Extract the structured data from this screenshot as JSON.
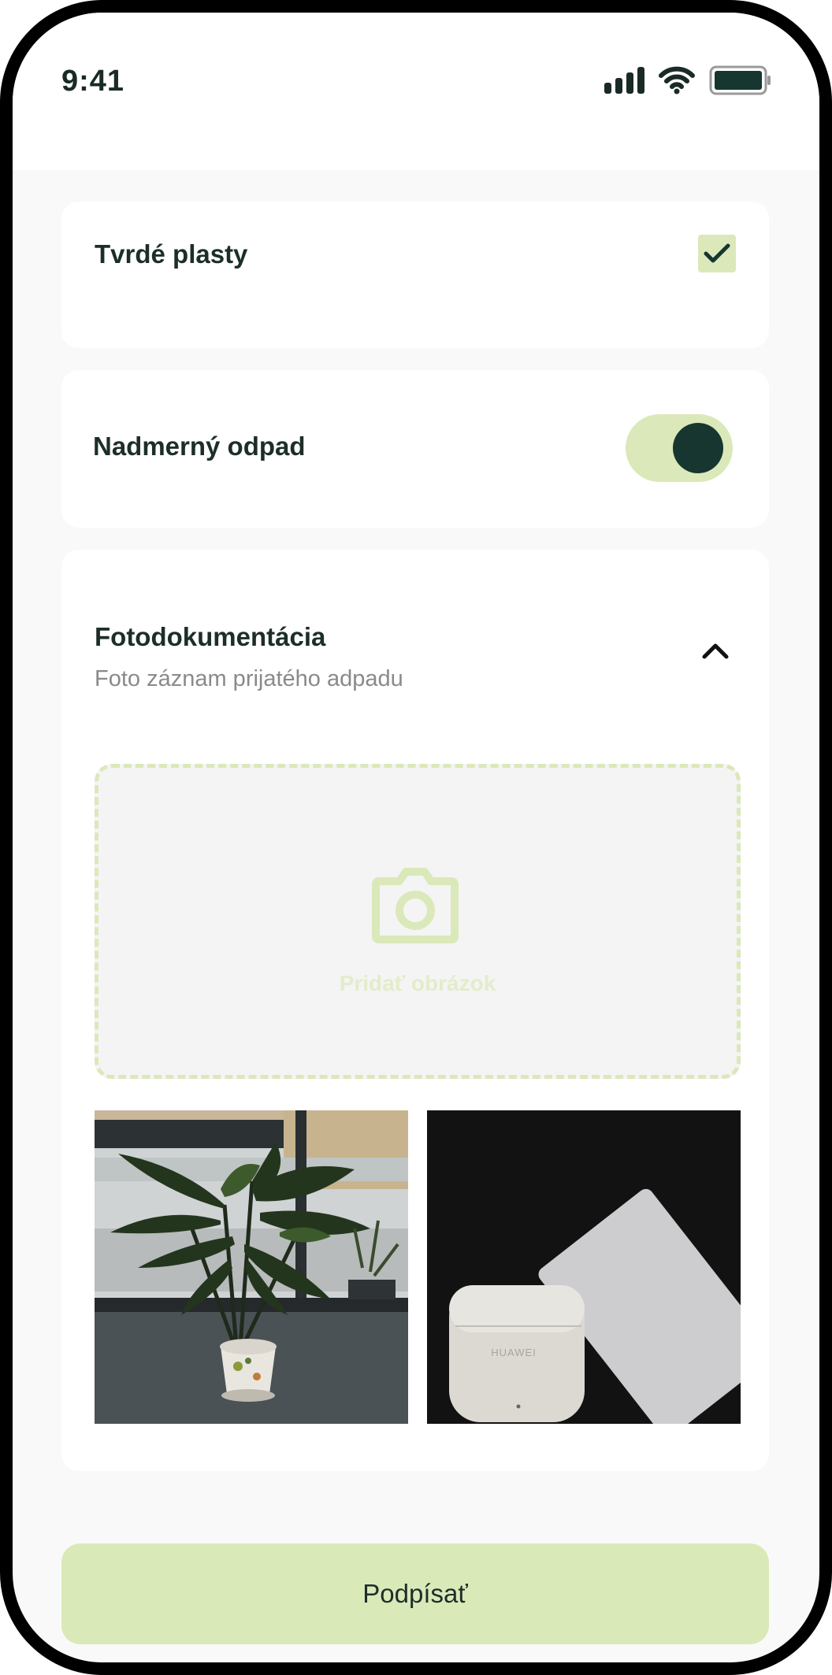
{
  "status_bar": {
    "time": "9:41",
    "icons": [
      "signal-icon",
      "wifi-icon",
      "battery-icon"
    ]
  },
  "colors": {
    "accent_light": "#dbe8b9",
    "accent_dark": "#173630",
    "text_dark": "#1d2e2a",
    "text_muted": "#8a8a8a",
    "background": "#f9f9f9"
  },
  "items": {
    "hard_plastics": {
      "label": "Tvrdé plasty",
      "checked": true
    },
    "excess_waste": {
      "label": "Nadmerný odpad",
      "toggle_on": true
    }
  },
  "photo_section": {
    "title": "Fotodokumentácia",
    "subtitle": "Foto záznam prijatého adpadu",
    "expanded": true,
    "add_image_label": "Pridať obrázok",
    "photos": [
      {
        "name": "photo-plant",
        "wordmark": ""
      },
      {
        "name": "photo-earbuds",
        "wordmark": "HUAWEI"
      }
    ]
  },
  "actions": {
    "sign_label": "Podpísať"
  }
}
